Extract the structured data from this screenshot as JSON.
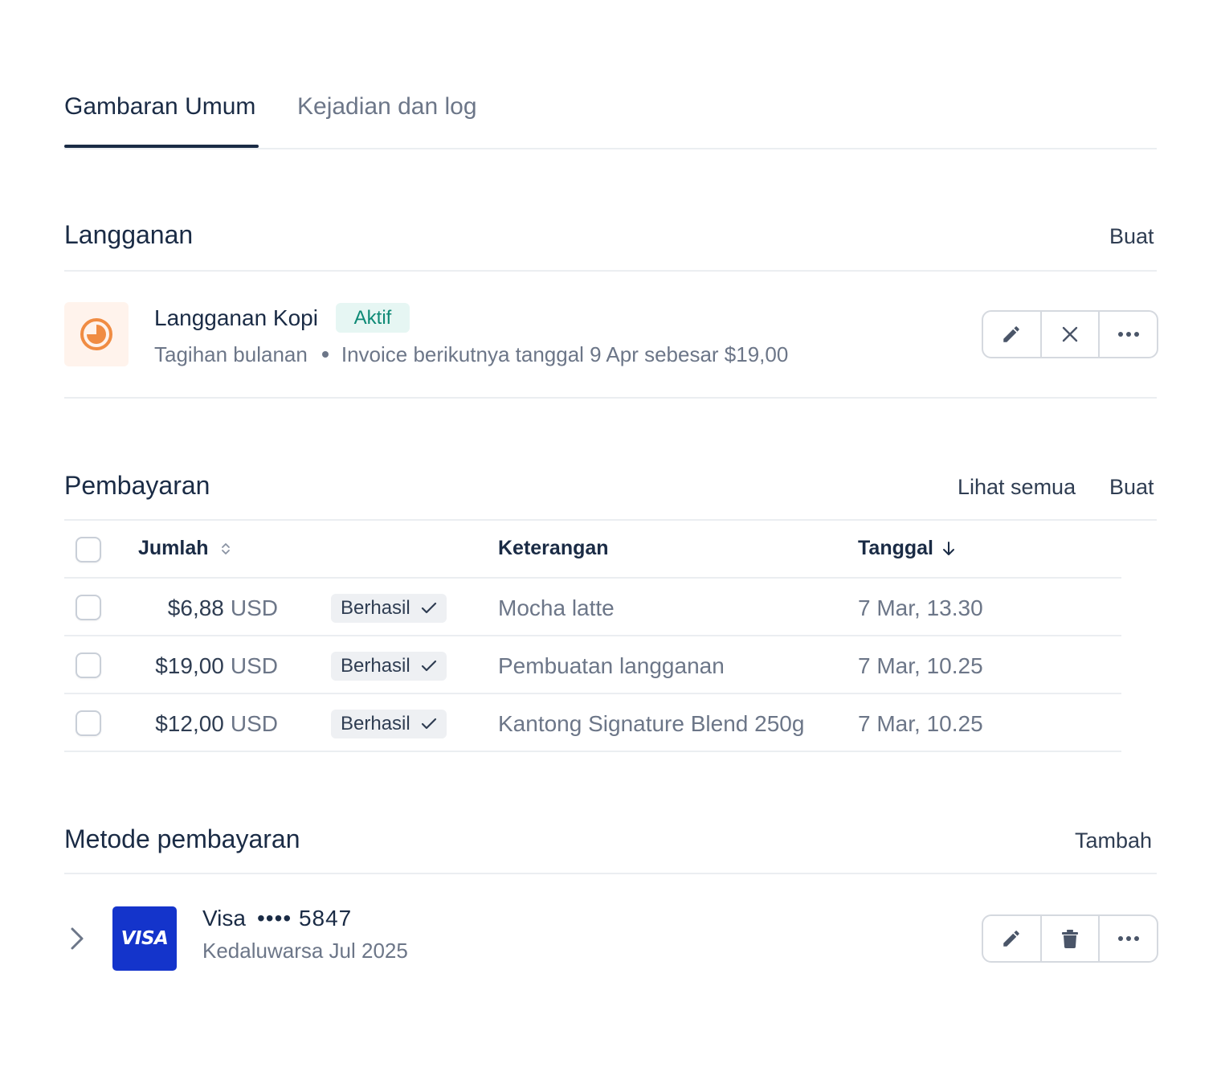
{
  "tabs": [
    {
      "label": "Gambaran Umum",
      "active": true
    },
    {
      "label": "Kejadian dan log",
      "active": false
    }
  ],
  "subscriptions": {
    "title": "Langganan",
    "create_label": "Buat",
    "item": {
      "icon": "subscription-clock-icon",
      "name": "Langganan Kopi",
      "status": "Aktif",
      "billing": "Tagihan bulanan",
      "next_invoice": "Invoice berikutnya tanggal 9 Apr sebesar $19,00",
      "actions": [
        "edit-icon",
        "close-icon",
        "more-icon"
      ]
    }
  },
  "payments": {
    "title": "Pembayaran",
    "view_all_label": "Lihat semua",
    "create_label": "Buat",
    "columns": {
      "amount": "Jumlah",
      "description": "Keterangan",
      "date": "Tanggal"
    },
    "rows": [
      {
        "amount": "$6,88",
        "currency": "USD",
        "status": "Berhasil",
        "description": "Mocha latte",
        "date": "7 Mar, 13.30"
      },
      {
        "amount": "$19,00",
        "currency": "USD",
        "status": "Berhasil",
        "description": "Pembuatan langganan",
        "date": "7 Mar, 10.25"
      },
      {
        "amount": "$12,00",
        "currency": "USD",
        "status": "Berhasil",
        "description": "Kantong Signature Blend 250g",
        "date": "7 Mar, 10.25"
      }
    ]
  },
  "payment_methods": {
    "title": "Metode pembayaran",
    "add_label": "Tambah",
    "item": {
      "brand_logo": "VISA",
      "brand": "Visa",
      "mask": "•••• 5847",
      "expiry": "Kedaluwarsa Jul 2025",
      "actions": [
        "edit-icon",
        "trash-icon",
        "more-icon"
      ]
    }
  },
  "colors": {
    "primary_text": "#1a2b45",
    "muted_text": "#6c7688",
    "active_badge_bg": "#e6f6f3",
    "active_badge_text": "#0e8a76",
    "visa_blue": "#1434cb",
    "subscription_icon": "#f08c43"
  }
}
